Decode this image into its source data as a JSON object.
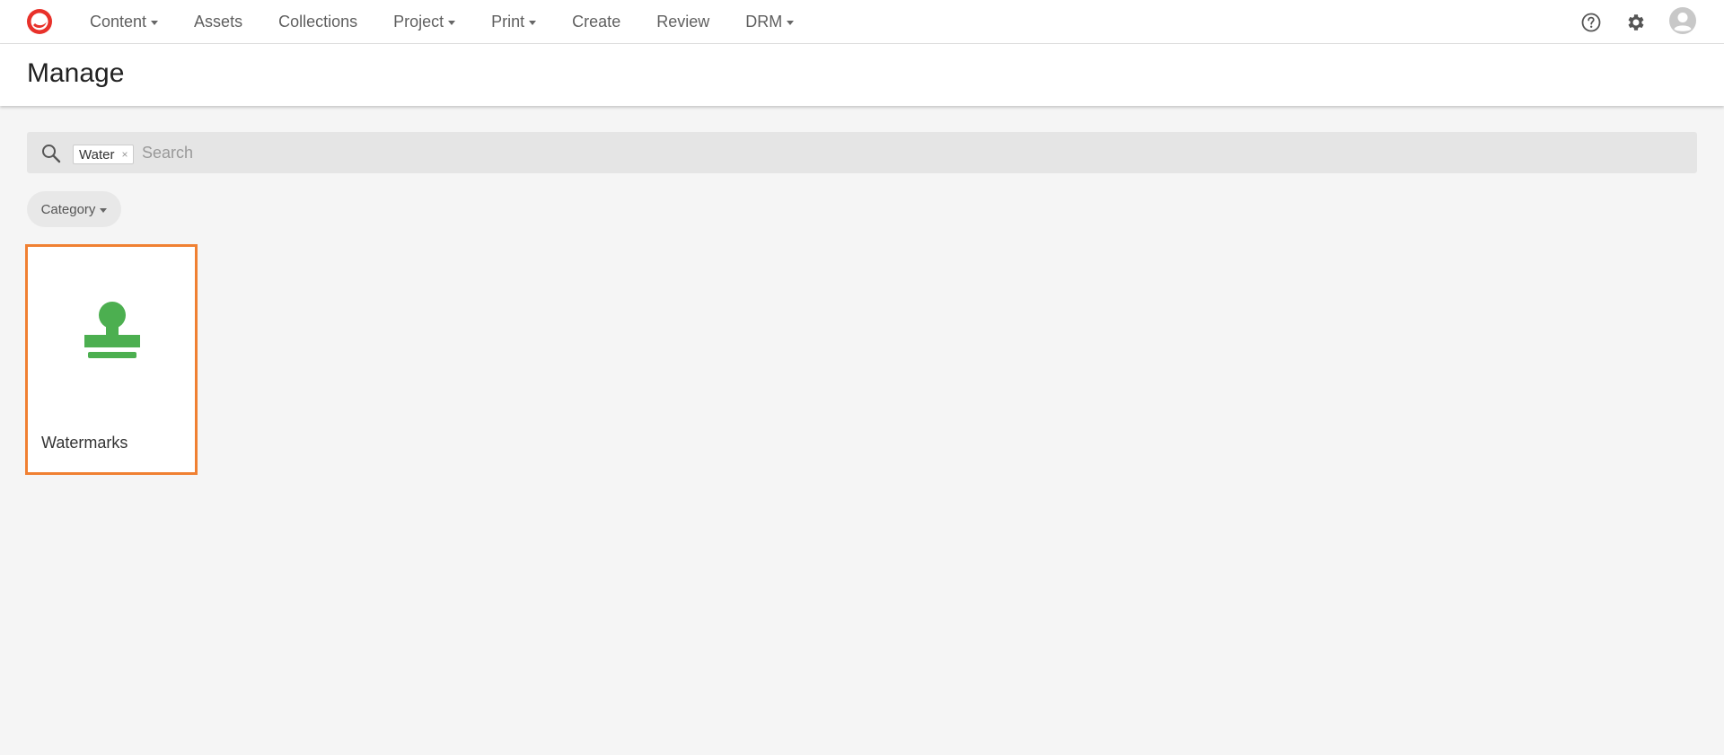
{
  "topnav": {
    "logo_icon": "app-logo",
    "items": [
      {
        "label": "Content",
        "has_dropdown": true
      },
      {
        "label": "Assets",
        "has_dropdown": false
      },
      {
        "label": "Collections",
        "has_dropdown": false
      },
      {
        "label": "Project",
        "has_dropdown": true
      },
      {
        "label": "Print",
        "has_dropdown": true
      },
      {
        "label": "Create",
        "has_dropdown": false
      },
      {
        "label": "Review",
        "has_dropdown": false
      },
      {
        "label": "DRM",
        "has_dropdown": true
      }
    ],
    "right_icons": [
      "help-icon",
      "gear-icon",
      "avatar-icon"
    ]
  },
  "page": {
    "title": "Manage"
  },
  "search": {
    "chip_label": "Water",
    "chip_close": "×",
    "placeholder": "Search",
    "value": ""
  },
  "filters": {
    "category_label": "Category"
  },
  "cards": [
    {
      "label": "Watermarks",
      "icon": "stamp-icon",
      "selected": true
    }
  ],
  "colors": {
    "accent": "#f08032",
    "logo": "#e8312a",
    "stamp": "#4caf50"
  }
}
